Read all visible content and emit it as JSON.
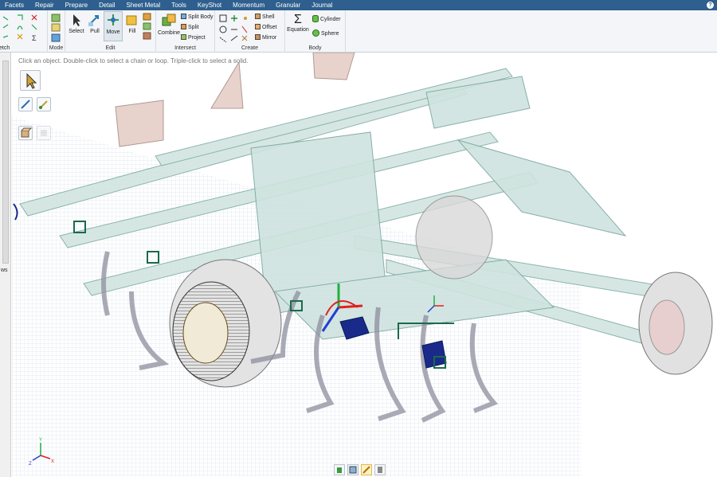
{
  "menu": {
    "items": [
      "Facets",
      "Repair",
      "Prepare",
      "Detail",
      "Sheet Metal",
      "Tools",
      "KeyShot",
      "Momentum",
      "Granular",
      "Journal"
    ],
    "help": "?"
  },
  "ribbon": {
    "sketch_label": "etch",
    "mode": {
      "label": "Mode"
    },
    "edit": {
      "label": "Edit",
      "select": "Select",
      "pull": "Pull",
      "move": "Move",
      "fill": "Fill"
    },
    "intersect": {
      "label": "Intersect",
      "combine": "Combine",
      "split_body": "Split Body",
      "split": "Split",
      "project": "Project"
    },
    "create": {
      "label": "Create",
      "shell": "Shell",
      "offset": "Offset",
      "mirror": "Mirror"
    },
    "body": {
      "label": "Body",
      "equation": "Equation",
      "cylinder": "Cylinder",
      "sphere": "Sphere",
      "sigma": "Σ"
    }
  },
  "left_panel": {
    "truncated_label": "ws"
  },
  "canvas": {
    "hint": "Click an object.  Double-click to select a chain or loop.  Triple-click to select a solid.",
    "triad": {
      "x": "X",
      "y": "Y",
      "z": "Z"
    }
  },
  "colors": {
    "menubar": "#2e5f8e",
    "model_fill": "#cfe3df",
    "model_line": "#7aa7a0",
    "grid_line": "#c7d3e6",
    "wheel": "#d9d9d9",
    "handle_red": "#e02020",
    "handle_green": "#20b040",
    "handle_blue": "#2040d0",
    "selected": "#1a2a8a"
  }
}
